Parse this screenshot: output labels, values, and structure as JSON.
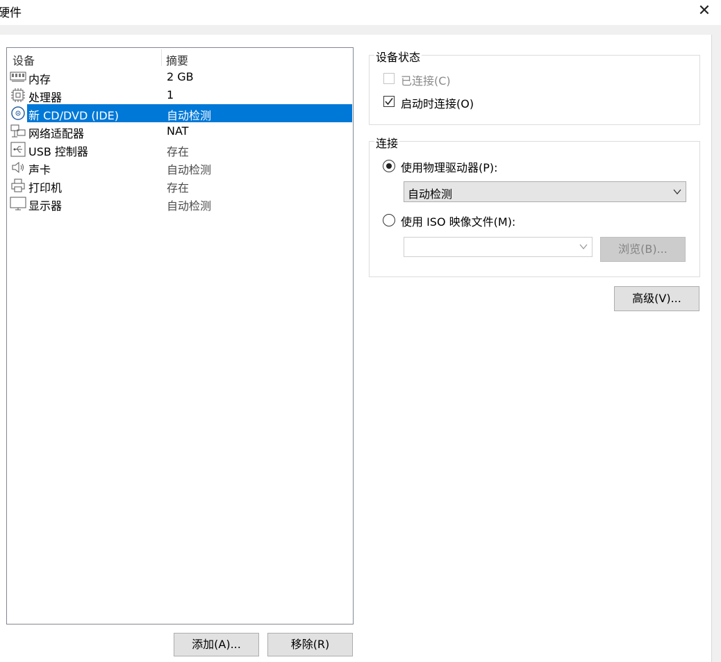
{
  "window": {
    "title": "硬件",
    "close_glyph": "✕"
  },
  "device_list": {
    "columns": {
      "device": "设备",
      "summary": "摘要"
    },
    "items": [
      {
        "name": "内存",
        "summary": "2 GB",
        "icon": "memory-icon"
      },
      {
        "name": "处理器",
        "summary": "1",
        "icon": "processor-icon"
      },
      {
        "name": "新 CD/DVD (IDE)",
        "summary": "自动检测",
        "icon": "cd-dvd-icon",
        "selected": true
      },
      {
        "name": "网络适配器",
        "summary": "NAT",
        "icon": "network-adapter-icon"
      },
      {
        "name": "USB 控制器",
        "summary": "存在",
        "icon": "usb-icon"
      },
      {
        "name": "声卡",
        "summary": "自动检测",
        "icon": "speaker-icon"
      },
      {
        "name": "打印机",
        "summary": "存在",
        "icon": "printer-icon"
      },
      {
        "name": "显示器",
        "summary": "自动检测",
        "icon": "monitor-icon"
      }
    ]
  },
  "buttons": {
    "add": "添加(A)...",
    "remove": "移除(R)",
    "advanced": "高级(V)...",
    "browse": "浏览(B)..."
  },
  "device_status": {
    "title": "设备状态",
    "connected": {
      "label": "已连接(C)",
      "checked": false,
      "enabled": false
    },
    "connect_at_power_on": {
      "label": "启动时连接(O)",
      "checked": true,
      "enabled": true
    }
  },
  "connection": {
    "title": "连接",
    "use_physical_drive": {
      "label": "使用物理驱动器(P):",
      "selected": true
    },
    "physical_drive_value": "自动检测",
    "use_iso": {
      "label": "使用 ISO 映像文件(M):",
      "selected": false
    },
    "iso_path": ""
  }
}
